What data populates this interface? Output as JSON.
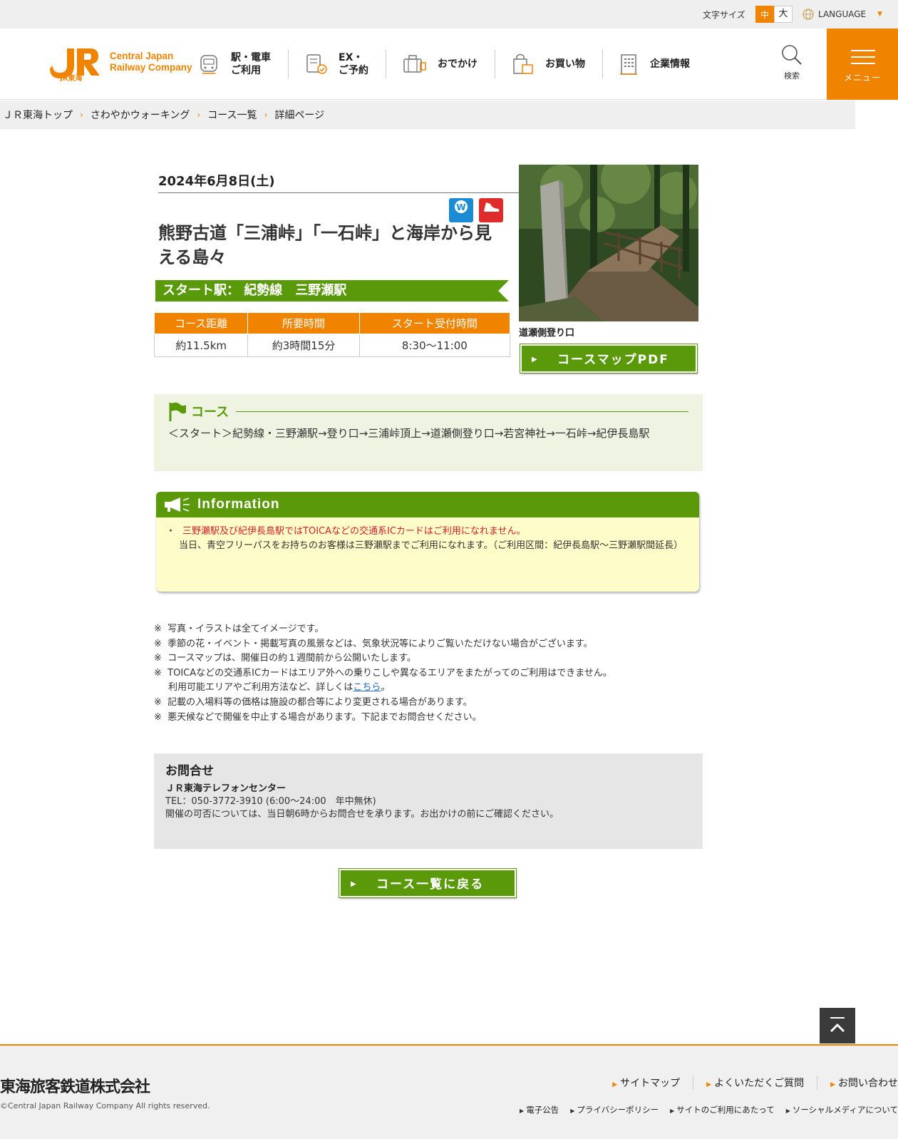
{
  "utility": {
    "font_size_label": "文字サイズ",
    "font_size_mid": "中",
    "font_size_large": "大",
    "language": "LANGUAGE"
  },
  "header": {
    "logo_line1": "Central Japan",
    "logo_line2": "Railway Company",
    "logo_mark_sub": "JR東海",
    "nav": [
      {
        "label": "駅・電車\nご利用",
        "icon": "train-icon"
      },
      {
        "label": "EX・\nご予約",
        "icon": "reservation-icon"
      },
      {
        "label": "おでかけ",
        "icon": "suitcase-icon"
      },
      {
        "label": "お買い物",
        "icon": "shopping-bag-icon"
      },
      {
        "label": "企業情報",
        "icon": "building-icon"
      }
    ],
    "search_label": "検索",
    "menu_label": "メニュー"
  },
  "breadcrumb": [
    "ＪＲ東海トップ",
    "さわやかウォーキング",
    "コース一覧",
    "詳細ページ"
  ],
  "event": {
    "date": "2024年6月8日(土)",
    "badge_w": "Wポイント",
    "badge_h": "健脚向",
    "title": "熊野古道「三浦峠」「一石峠」と海岸から見える島々",
    "start_station": "スタート駅：  紀勢線　三野瀬駅",
    "stats_headers": [
      "コース距離",
      "所要時間",
      "スタート受付時間"
    ],
    "stats_values": [
      "約11.5km",
      "約3時間15分",
      "8:30～11:00"
    ],
    "photo_caption": "道瀬側登り口",
    "pdf_button": "コースマップPDF"
  },
  "course": {
    "heading": "コース",
    "route": "＜スタート＞紀勢線・三野瀬駅→登り口→三浦峠頂上→道瀬側登り口→若宮神社→一石峠→紀伊長島駅"
  },
  "info": {
    "heading": "Information",
    "bullet": "・",
    "line1": "三野瀬駅及び紀伊長島駅ではTOICAなどの交通系ICカードはご利用になれません。",
    "line2": "当日、青空フリーパスをお持ちのお客様は三野瀬駅までご利用になれます。（ご利用区間：紀伊長島駅～三野瀬駅間延長）"
  },
  "notes": {
    "mark": "※",
    "n1": "写真・イラストは全てイメージです。",
    "n2": "季節の花・イベント・掲載写真の風景などは、気象状況等によりご覧いただけない場合がございます。",
    "n3": "コースマップは、開催日の約１週間前から公開いたします。",
    "n4a": "TOICAなどの交通系ICカードはエリア外への乗りこしや異なるエリアをまたがってのご利用はできません。",
    "n4b": "利用可能エリアやご利用方法など、詳しくは",
    "n4link": "こちら",
    "n4end": "。",
    "n5": "記載の入場料等の価格は施設の都合等により変更される場合があります。",
    "n6": "悪天候などで開催を中止する場合があります。下記までお問合せください。"
  },
  "contact": {
    "title": "お問合せ",
    "center": "ＪＲ東海テレフォンセンター",
    "tel": "TEL：050-3772-3910 (6:00～24:00　年中無休)",
    "note": "開催の可否については、当日朝6時からお問合せを承ります。お出かけの前にご確認ください。"
  },
  "back_button": "コース一覧に戻る",
  "footer": {
    "company": "東海旅客鉄道株式会社",
    "copyright": "©Central Japan Railway Company All rights reserved.",
    "links_main": [
      "サイトマップ",
      "よくいただくご質問",
      "お問い合わせ"
    ],
    "links_sub": [
      "電子公告",
      "プライバシーポリシー",
      "サイトのご利用にあたって",
      "ソーシャルメディアについて"
    ]
  },
  "colors": {
    "brand_orange": "#f08300",
    "green": "#5a9a0a",
    "info_bg": "#fefcc8",
    "alert_red": "#d0202a"
  }
}
